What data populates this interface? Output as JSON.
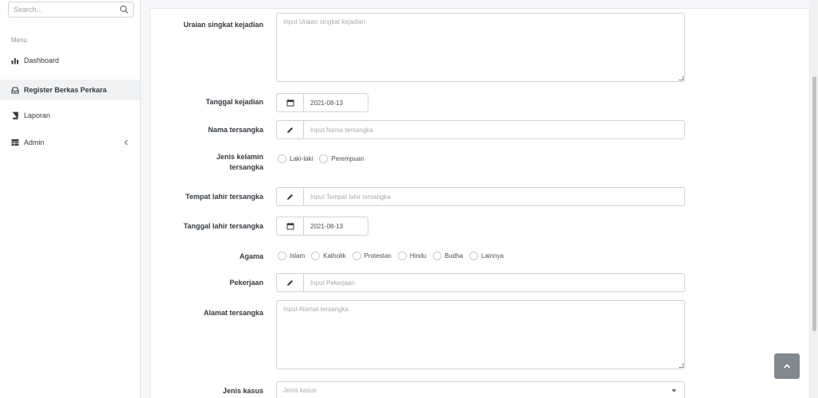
{
  "sidebar": {
    "search": {
      "placeholder": "Search..."
    },
    "menu_header": "Menu",
    "items": [
      {
        "label": "Dashboard",
        "icon": "chart-icon",
        "active": false
      },
      {
        "label": "Register Berkas Perkara",
        "icon": "inbox-icon",
        "active": true
      },
      {
        "label": "Laporan",
        "icon": "book-icon",
        "active": false
      },
      {
        "label": "Admin",
        "icon": "table-icon",
        "active": false,
        "has_children": true
      }
    ]
  },
  "form": {
    "uraian": {
      "label": "Uraian singkat kejadian",
      "placeholder": "Input Uraian singkat kejadian"
    },
    "tanggal_kejadian": {
      "label": "Tanggal kejadian",
      "value": "2021-08-13"
    },
    "nama_tersangka": {
      "label": "Nama tersangka",
      "placeholder": "Input Nama tersangka"
    },
    "jenis_kelamin": {
      "label_line1": "Jenis kelamin",
      "label_line2": "tersangka",
      "options": [
        "Laki-laki",
        "Perempuan"
      ]
    },
    "tempat_lahir": {
      "label": "Tempat lahir tersangka",
      "placeholder": "Input Tempat lahir tersangka"
    },
    "tanggal_lahir": {
      "label": "Tanggal lahir tersangka",
      "value": "2021-08-13"
    },
    "agama": {
      "label": "Agama",
      "options": [
        "Islam",
        "Katholik",
        "Protestan",
        "Hindu",
        "Budha",
        "Lainnya"
      ]
    },
    "pekerjaan": {
      "label": "Pekerjaan",
      "placeholder": "Input Pekerjaan"
    },
    "alamat": {
      "label": "Alamat tersangka",
      "placeholder": "Input Alamat tersangka"
    },
    "jenis_kasus": {
      "label": "Jenis kasus",
      "placeholder": "Jenis kasus"
    }
  },
  "colors": {
    "accent": "#6c757d",
    "border": "#ced4da",
    "sidebar_active": "#f1f2f4"
  }
}
